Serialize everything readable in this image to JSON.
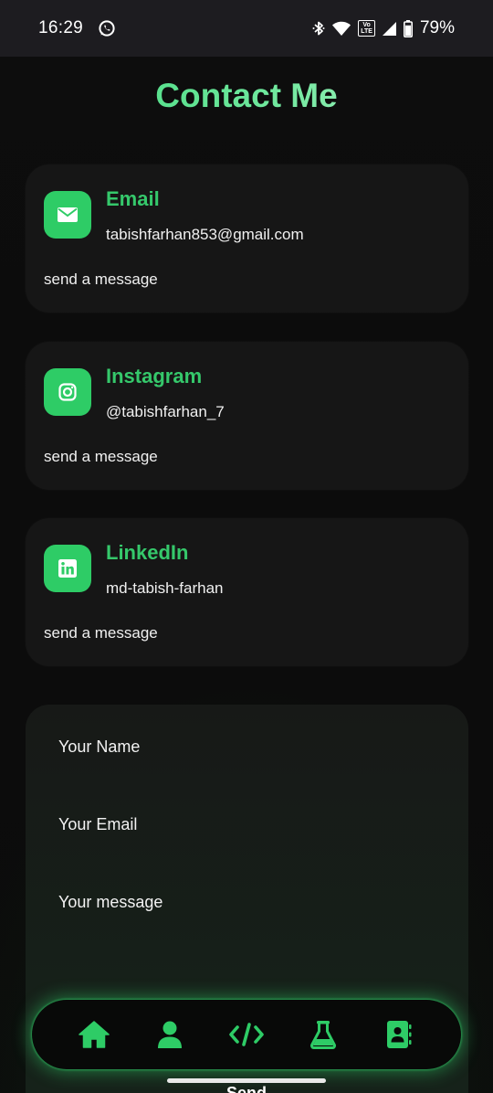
{
  "status_bar": {
    "time": "16:29",
    "battery_percent": "79%",
    "network_badge_top": "Vo",
    "network_badge_bottom": "LTE",
    "icons": [
      "whatsapp-icon",
      "bluetooth-icon",
      "wifi-icon",
      "cell-signal-icon",
      "battery-icon"
    ]
  },
  "page": {
    "title": "Contact Me"
  },
  "contacts": [
    {
      "title": "Email",
      "detail": "tabishfarhan853@gmail.com",
      "action": "send a message",
      "icon": "mail-icon"
    },
    {
      "title": "Instagram",
      "detail": "@tabishfarhan_7",
      "action": "send a message",
      "icon": "instagram-icon"
    },
    {
      "title": "LinkedIn",
      "detail": "md-tabish-farhan",
      "action": "send a message",
      "icon": "linkedin-icon"
    }
  ],
  "form": {
    "name_placeholder": "Your Name",
    "email_placeholder": "Your Email",
    "message_placeholder": "Your message",
    "name_value": "",
    "email_value": "",
    "message_value": "",
    "submit_label": "Send"
  },
  "bottom_nav": {
    "items": [
      {
        "name": "home",
        "icon": "home-icon"
      },
      {
        "name": "about",
        "icon": "user-icon"
      },
      {
        "name": "projects",
        "icon": "code-icon"
      },
      {
        "name": "experiments",
        "icon": "flask-icon"
      },
      {
        "name": "contact",
        "icon": "contact-book-icon"
      }
    ]
  },
  "colors": {
    "accent": "#2ecc66",
    "accent_text": "#35c86b",
    "background": "#0c0c0c",
    "card": "#161616",
    "status_bar": "#1d1c20"
  }
}
